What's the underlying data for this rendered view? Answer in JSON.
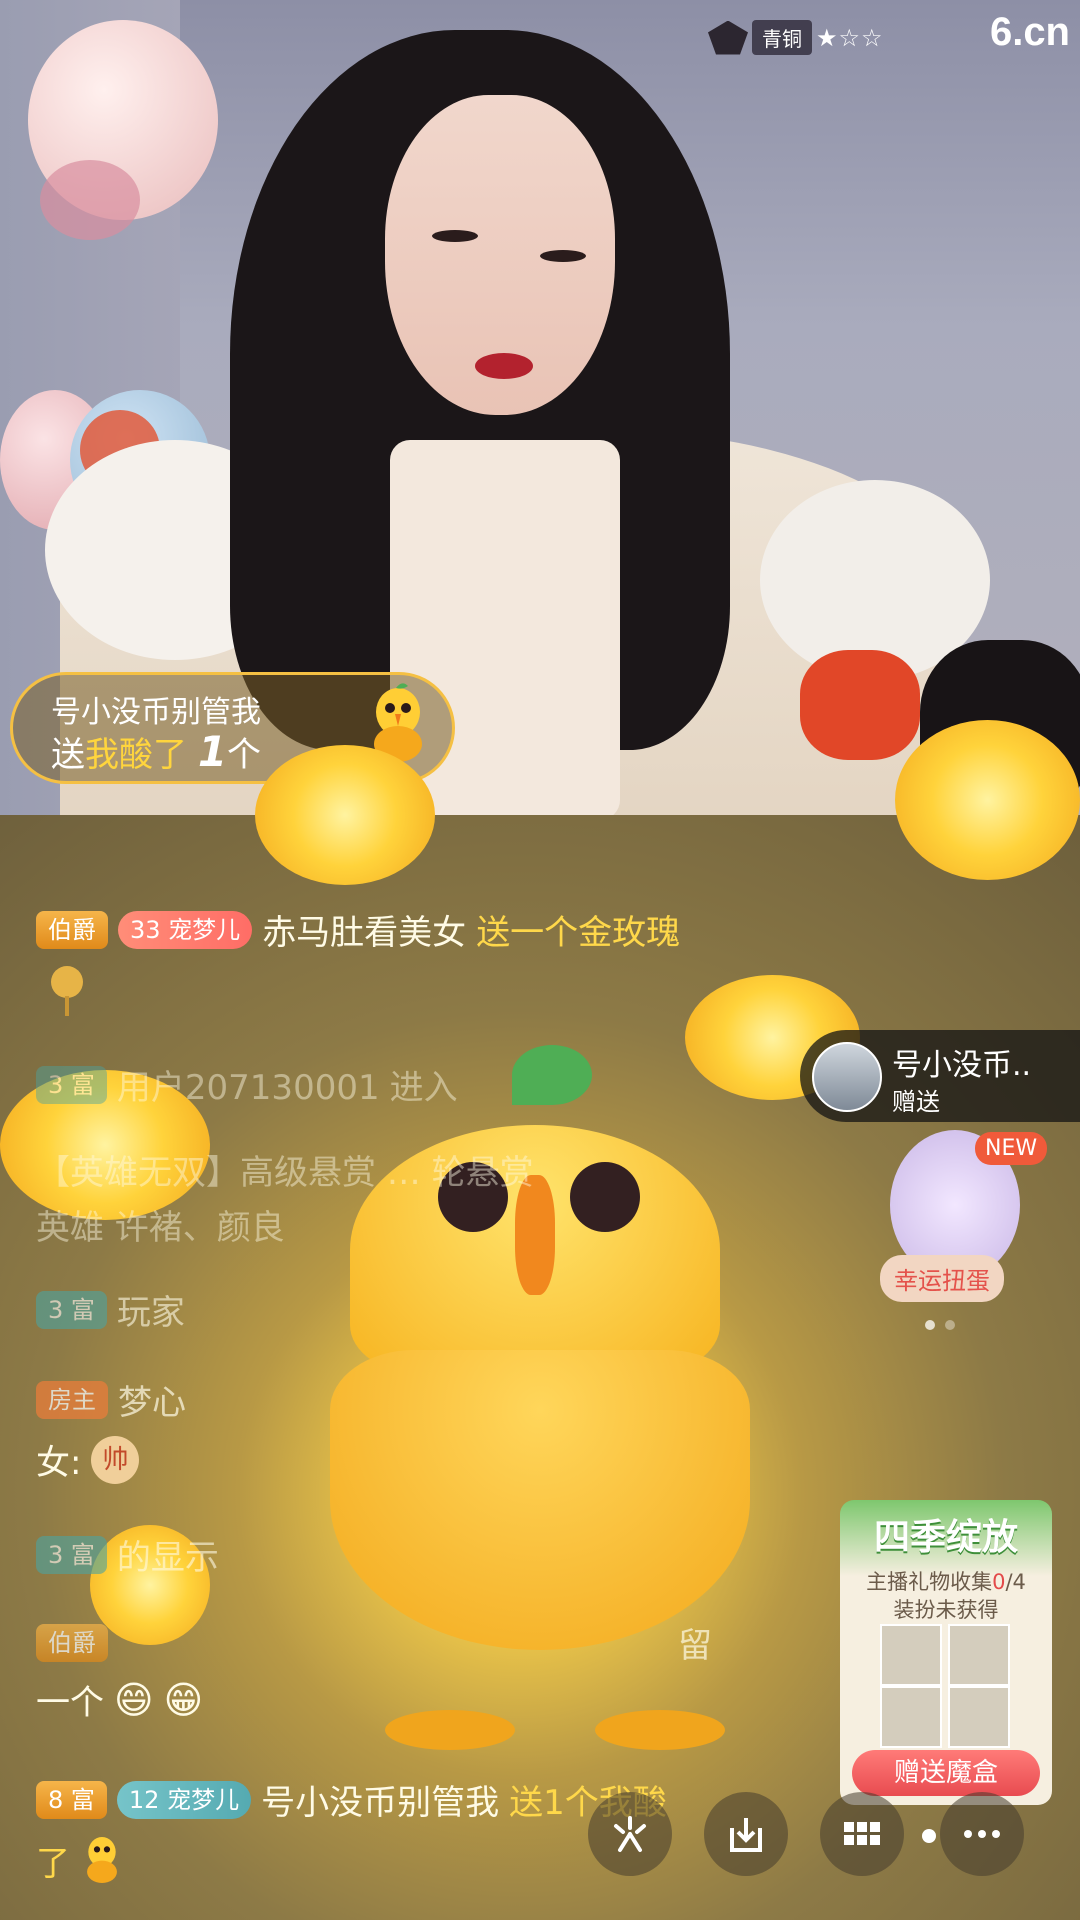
{
  "stream": {
    "rank_label": "青铜",
    "rank_stars": "★☆☆",
    "site_logo": "6.cn"
  },
  "gift_popup": {
    "user": "号小没币别管我",
    "send_word": "送",
    "gift_name": "我酸了",
    "count": "1",
    "unit": "个"
  },
  "chat": [
    {
      "badge": "伯爵",
      "pet_level": "33",
      "pet": "宠梦儿",
      "name": "赤马肚看美女",
      "text": "送一个金玫瑰"
    },
    {
      "badge": "3 富",
      "name": "用户207130001",
      "text": "进入"
    },
    {
      "text": "【英雄无双】高级悬赏 … 轮悬赏"
    },
    {
      "text": "英雄 许褚、颜良"
    },
    {
      "badge": "3 富",
      "text": "玩家"
    },
    {
      "badge": "房主",
      "text": "梦心"
    },
    {
      "text": "女:"
    },
    {
      "badge": "3 富",
      "text": "的显示"
    },
    {
      "badge": "伯爵",
      "text": "留"
    },
    {
      "text": "一个"
    },
    {
      "badge": "8 富",
      "pet_level": "12",
      "pet": "宠梦儿",
      "name": "号小没币别管我",
      "text": "送1个我酸"
    },
    {
      "text": "了"
    }
  ],
  "side_card": {
    "name": "号小没币..",
    "action": "赠送"
  },
  "lucky_egg": {
    "new_label": "NEW",
    "label": "幸运扭蛋"
  },
  "season_event": {
    "title": "四季绽放",
    "collect_prefix": "主播礼物收集",
    "collect_count": "0",
    "collect_total": "/4",
    "status": "装扮未获得",
    "button": "赠送魔盒"
  },
  "toolbar": {
    "icons": [
      "sparkle-icon",
      "download-icon",
      "grid-icon",
      "more-icon"
    ]
  },
  "colors": {
    "gold_text": "#ffd84a",
    "pill_border": "#f5c043"
  }
}
